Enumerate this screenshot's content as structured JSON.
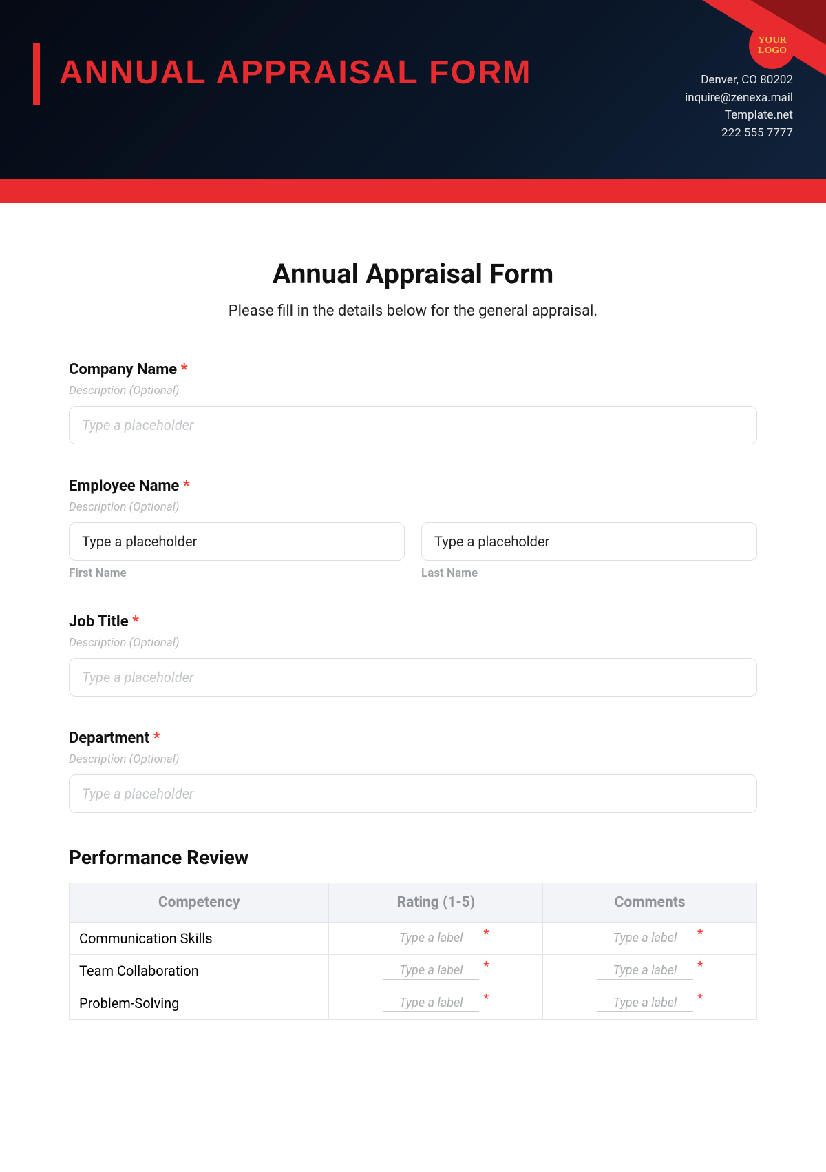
{
  "header": {
    "title": "ANNUAL APPRAISAL FORM",
    "logo_text": "YOUR LOGO",
    "contact": {
      "line1": "Denver, CO 80202",
      "line2": "inquire@zenexa.mail",
      "line3": "Template.net",
      "line4": "222 555 7777"
    }
  },
  "form": {
    "title": "Annual Appraisal Form",
    "subtitle": "Please fill in the details below for the general appraisal.",
    "desc_hint": "Description (Optional)",
    "required_mark": "*",
    "ph_italic": "Type a placeholder",
    "ph_plain": "Type a placeholder",
    "cell_ph": "Type a label",
    "fields": {
      "company": {
        "label": "Company Name"
      },
      "employee": {
        "label": "Employee Name",
        "first_sub": "First Name",
        "last_sub": "Last Name"
      },
      "jobtitle": {
        "label": "Job Title"
      },
      "department": {
        "label": "Department"
      }
    },
    "perf": {
      "title": "Performance Review",
      "cols": {
        "c1": "Competency",
        "c2": "Rating (1-5)",
        "c3": "Comments"
      },
      "rows": [
        {
          "name": "Communication Skills"
        },
        {
          "name": "Team Collaboration"
        },
        {
          "name": "Problem-Solving"
        }
      ]
    }
  }
}
